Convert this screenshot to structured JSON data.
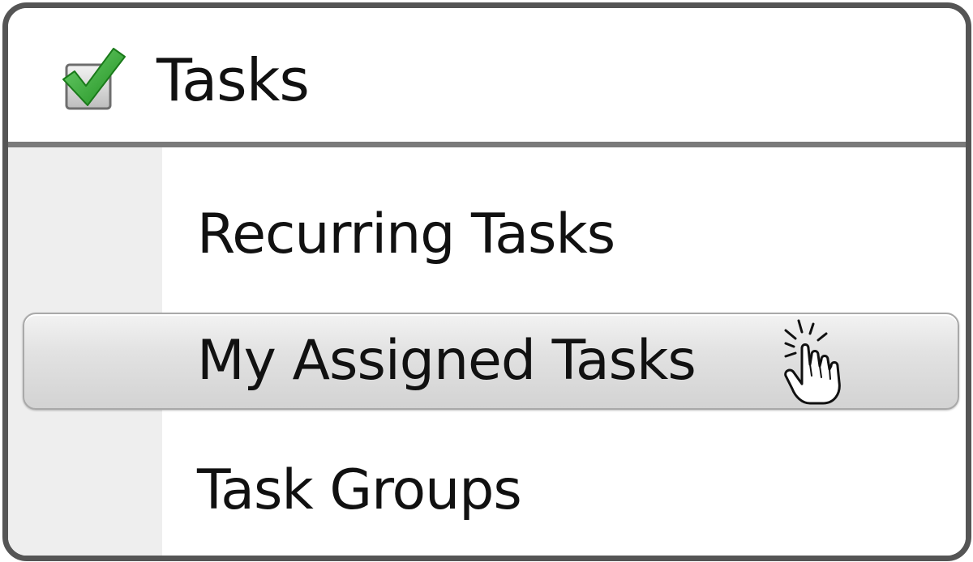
{
  "header": {
    "title": "Tasks",
    "icon": "checkbox-checked-icon"
  },
  "menu": {
    "items": [
      {
        "label": "Recurring Tasks",
        "selected": false
      },
      {
        "label": "My Assigned Tasks",
        "selected": true
      },
      {
        "label": "Task Groups",
        "selected": false
      }
    ]
  },
  "cursor": {
    "icon": "pointer-hand-click-icon"
  },
  "colors": {
    "frame_border": "#555555",
    "divider": "#7a7a7a",
    "gutter": "#eeeeee",
    "check_green": "#2aa52a",
    "highlight_top": "#f3f3f3",
    "highlight_bottom": "#d3d3d3"
  }
}
